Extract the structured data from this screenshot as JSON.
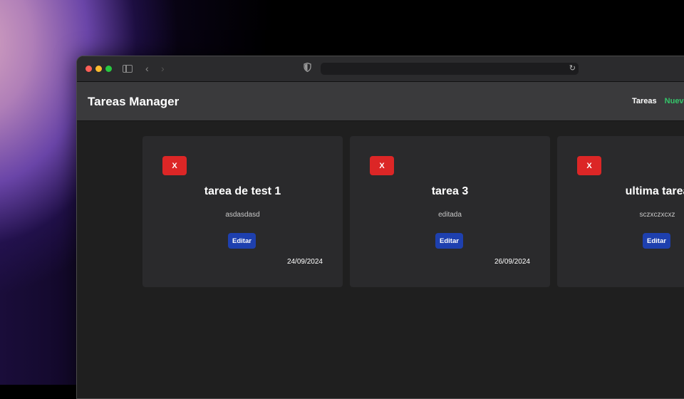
{
  "app": {
    "title": "Tareas Manager"
  },
  "nav": {
    "tareas_label": "Tareas",
    "nueva_label": "Nueva"
  },
  "tasks": [
    {
      "delete_label": "X",
      "title": "tarea de test 1",
      "description": "asdasdasd",
      "edit_label": "Editar",
      "date": "24/09/2024"
    },
    {
      "delete_label": "X",
      "title": "tarea 3",
      "description": "editada",
      "edit_label": "Editar",
      "date": "26/09/2024"
    },
    {
      "delete_label": "X",
      "title": "ultima tarea",
      "description": "sczxczxcxz",
      "edit_label": "Editar",
      "date": ""
    }
  ],
  "colors": {
    "delete": "#dc2626",
    "edit": "#1e40af",
    "nav_accent": "#34c56a"
  }
}
